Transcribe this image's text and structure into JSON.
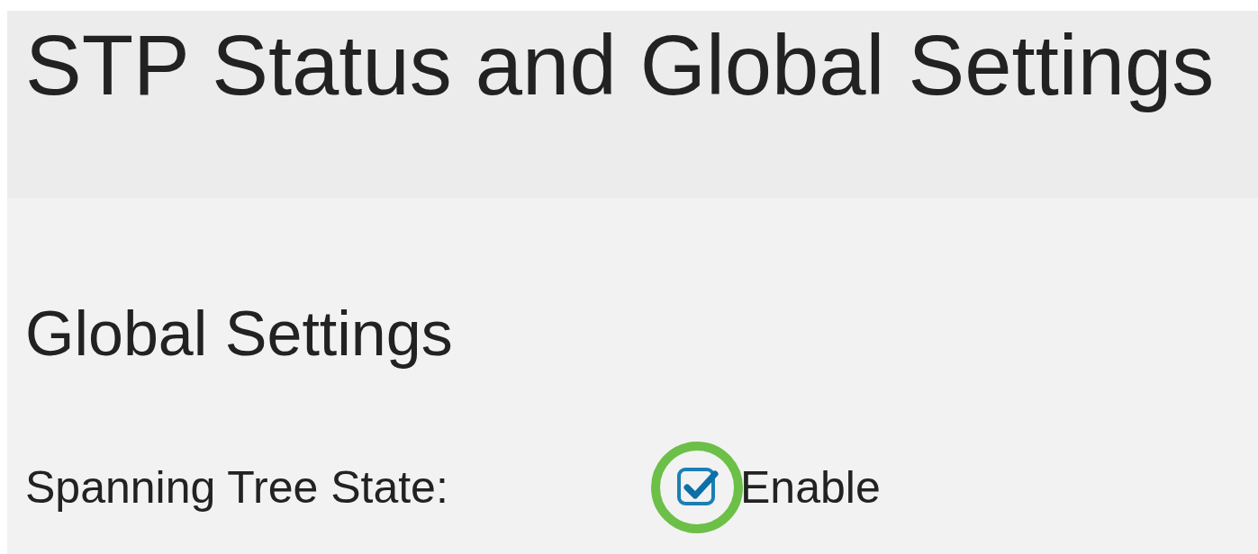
{
  "page": {
    "title": "STP Status and Global Settings"
  },
  "section": {
    "title": "Global Settings"
  },
  "fields": [
    {
      "label": "Spanning Tree State:",
      "kind": "checkbox",
      "option": "Enable",
      "checked": true,
      "highlighted": true
    }
  ]
}
